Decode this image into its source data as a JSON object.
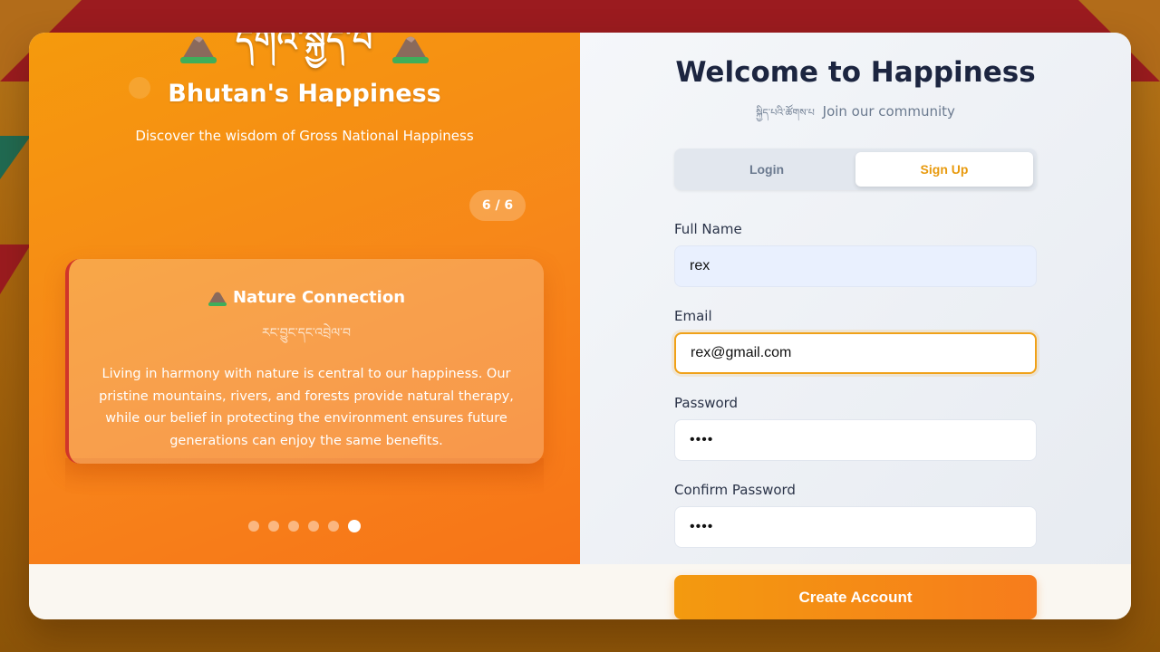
{
  "colors": {
    "accent": "#f39a0f",
    "accent_dark": "#f77418",
    "tab_active_text": "#e89a0e",
    "heading": "#1c2540",
    "flag_red": "#9b1b1f",
    "flag_green": "#1f6b52"
  },
  "hero": {
    "tibetan_title": "དགའ་སྐྱིད་པ",
    "title": "Bhutan's Happiness",
    "subtitle": "Discover the wisdom of Gross National Happiness",
    "icon": "mountain-icon"
  },
  "carousel": {
    "counter": "6 / 6",
    "slide": {
      "icon": "mountain-icon",
      "title": "Nature Connection",
      "tibetan": "རང་བྱུང་དང་འབྲེལ་བ",
      "body": "Living in harmony with nature is central to our happiness. Our pristine mountains, rivers, and forests provide natural therapy, while our belief in protecting the environment ensures future generations can enjoy the same benefits."
    },
    "dots_total": 6,
    "active_dot": 6
  },
  "form": {
    "title": "Welcome to Happiness",
    "subtitle_tibetan": "སྐྱིད་པའི་ཚོགས་པ",
    "subtitle": "Join our community",
    "tabs": [
      {
        "label": "Login",
        "active": false
      },
      {
        "label": "Sign Up",
        "active": true
      }
    ],
    "fields": {
      "full_name": {
        "label": "Full Name",
        "value": "rex"
      },
      "email": {
        "label": "Email",
        "value": "rex@gmail.com"
      },
      "password": {
        "label": "Password",
        "value": "••••"
      },
      "confirm_password": {
        "label": "Confirm Password",
        "value": "••••"
      }
    },
    "submit_label": "Create Account"
  }
}
